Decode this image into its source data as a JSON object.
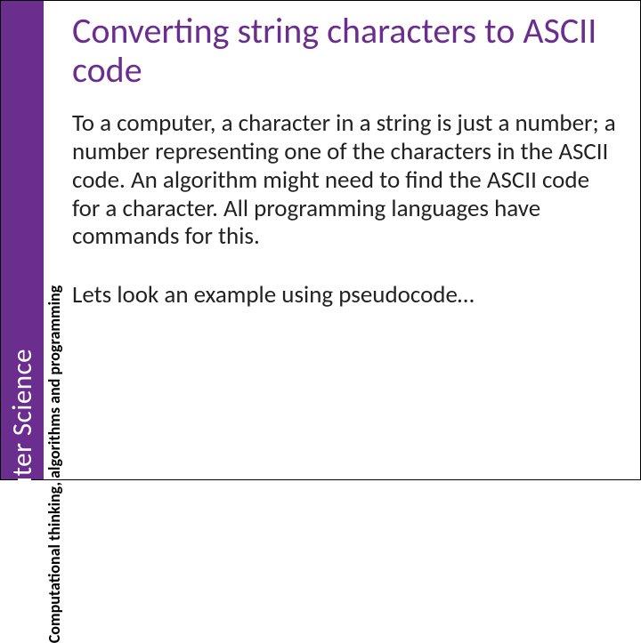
{
  "sidebar": {
    "main_label": "Computer Science",
    "sub_label": "Computational thinking, algorithms and programming"
  },
  "content": {
    "heading": "Converting string characters to ASCII code",
    "para1": "To a computer, a character in a string is just a number; a number representing one of the characters in the ASCII code. An algorithm might need to find the ASCII code for a character. All programming languages have commands for this.",
    "para2": "Lets look an example using pseudocode…"
  },
  "colors": {
    "accent": "#6b2e8f"
  }
}
